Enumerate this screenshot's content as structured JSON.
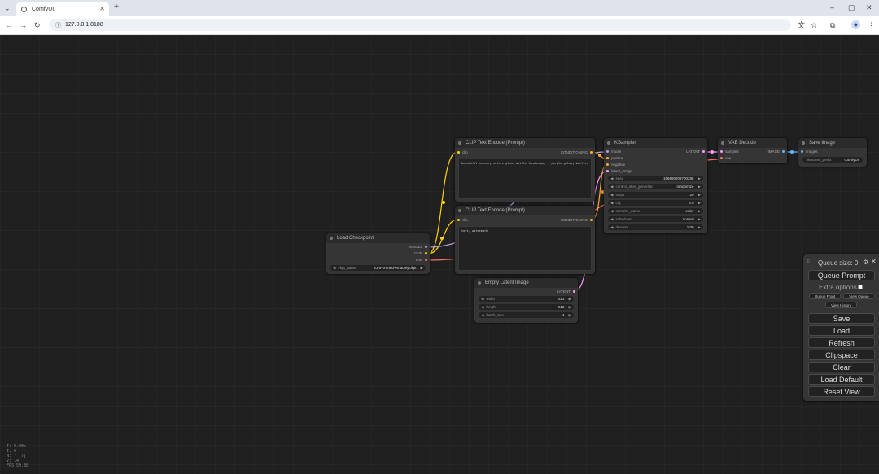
{
  "browser": {
    "tab_title": "ComfyUI",
    "url": "127.0.0.1:8188"
  },
  "nodes": {
    "clip_text_1": {
      "title": "CLIP Text Encode (Prompt)",
      "input_clip": "clip",
      "output": "CONDITIONING",
      "text": "beautiful scenery nature glass bottle landscape, , purple galaxy bottle,"
    },
    "clip_text_2": {
      "title": "CLIP Text Encode (Prompt)",
      "input_clip": "clip",
      "output": "CONDITIONING",
      "text": "text, watermark"
    },
    "load_checkpoint": {
      "title": "Load Checkpoint",
      "outputs": [
        "MODEL",
        "CLIP",
        "VAE"
      ],
      "ckpt_label": "ckpt_name",
      "ckpt_value": "v1-5-pruned-emaonly.ckpt"
    },
    "empty_latent": {
      "title": "Empty Latent Image",
      "output": "LATENT",
      "widgets": [
        {
          "label": "width",
          "value": "512"
        },
        {
          "label": "height",
          "value": "512"
        },
        {
          "label": "batch_size",
          "value": "1"
        }
      ]
    },
    "ksampler": {
      "title": "KSampler",
      "inputs": [
        "model",
        "positive",
        "negative",
        "latent_image"
      ],
      "output": "LATENT",
      "widgets": [
        {
          "label": "seed",
          "value": "156680208700286"
        },
        {
          "label": "control_after_generate",
          "value": "randomize"
        },
        {
          "label": "steps",
          "value": "20"
        },
        {
          "label": "cfg",
          "value": "8.0"
        },
        {
          "label": "sampler_name",
          "value": "euler"
        },
        {
          "label": "scheduler",
          "value": "normal"
        },
        {
          "label": "denoise",
          "value": "1.00"
        }
      ]
    },
    "vae_decode": {
      "title": "VAE Decode",
      "inputs": [
        "samples",
        "vae"
      ],
      "output": "IMAGE"
    },
    "save_image": {
      "title": "Save Image",
      "input": "images",
      "prefix_label": "filename_prefix",
      "prefix_value": "ComfyUI"
    }
  },
  "queue_panel": {
    "queue_size": "Queue size: 0",
    "queue_prompt": "Queue Prompt",
    "extra_options": "Extra options",
    "queue_front": "Queue Front",
    "view_queue": "View Queue",
    "view_history": "View History",
    "save": "Save",
    "load": "Load",
    "refresh": "Refresh",
    "clipspace": "Clipspace",
    "clear": "Clear",
    "load_default": "Load Default",
    "reset_view": "Reset View"
  },
  "stats": [
    "T: 0.00s",
    "I: 0",
    "N: 7 [7]",
    "V: 14",
    "FPS:59.88"
  ],
  "colors": {
    "clip": "#ffd500",
    "conditioning": "#ffa931",
    "model": "#b39ddb",
    "vae": "#ff6e6e",
    "latent": "#ff9cf9",
    "image": "#64b5f6"
  }
}
